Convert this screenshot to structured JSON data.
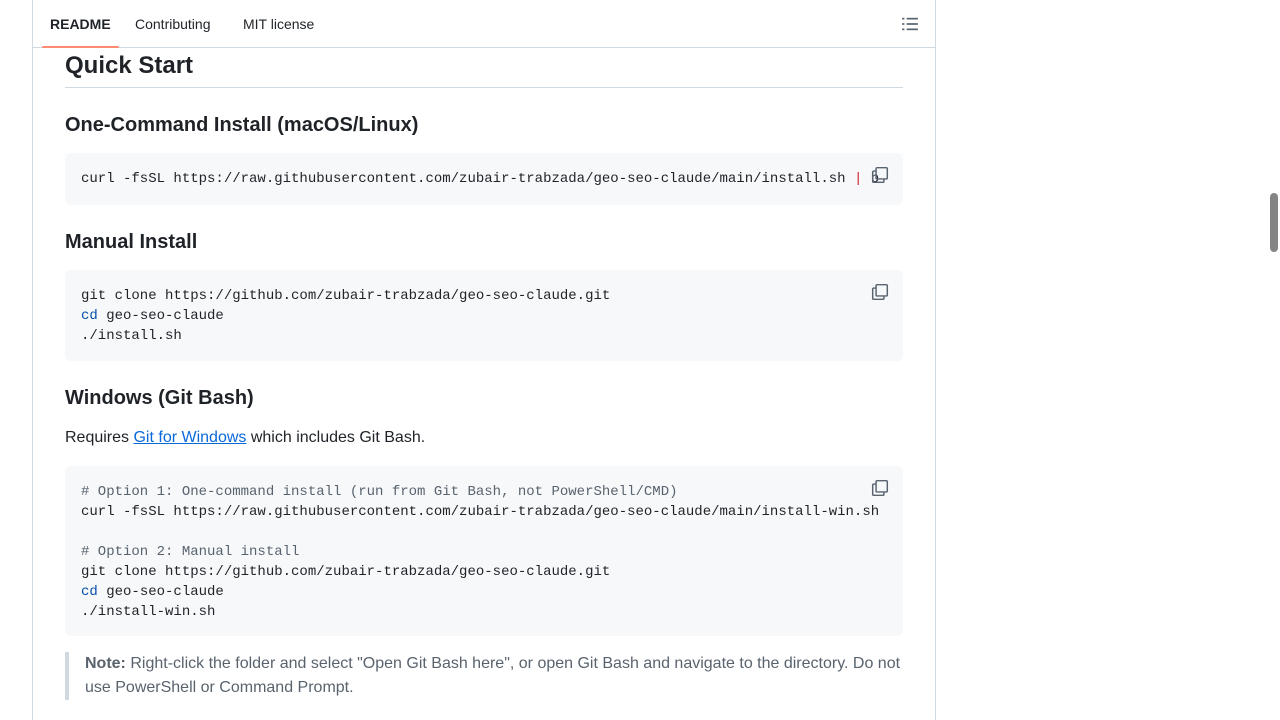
{
  "tabs": [
    {
      "label": "README"
    },
    {
      "label": "Contributing"
    },
    {
      "label": "MIT license"
    }
  ],
  "toc_icon": "list-unordered-icon",
  "copy_icon": "copy-icon",
  "quick_start": {
    "title": "Quick Start"
  },
  "one_command": {
    "title": "One-Command Install (macOS/Linux)",
    "code_before_pipe": "curl -fsSL https://raw.githubusercontent.com/zubair-trabzada/geo-seo-claude/main/install.sh ",
    "pipe": "|",
    "code_after_pipe": " b"
  },
  "manual_install": {
    "title": "Manual Install",
    "line1": "git clone https://github.com/zubair-trabzada/geo-seo-claude.git",
    "line2_cmd": "cd",
    "line2_rest": " geo-seo-claude",
    "line3": "./install.sh"
  },
  "windows": {
    "title": "Windows (Git Bash)",
    "requires_prefix": "Requires ",
    "requires_link": "Git for Windows",
    "requires_suffix": " which includes Git Bash.",
    "comment1": "# Option 1: One-command install (run from Git Bash, not PowerShell/CMD)",
    "line1": "curl -fsSL https://raw.githubusercontent.com/zubair-trabzada/geo-seo-claude/main/install-win.sh",
    "comment2": "# Option 2: Manual install",
    "line2": "git clone https://github.com/zubair-trabzada/geo-seo-claude.git",
    "line3_cmd": "cd",
    "line3_rest": " geo-seo-claude",
    "line4": "./install-win.sh"
  },
  "note": {
    "label": "Note:",
    "text": " Right-click the folder and select \"Open Git Bash here\", or open Git Bash and navigate to the directory. Do not use PowerShell or Command Prompt."
  },
  "colors": {
    "accent_tab_underline": "#fd8c73",
    "link": "#0969da",
    "code_bg": "#f6f8fa",
    "builtin": "#0550ae",
    "pipe": "#cf222e",
    "comment": "#59636e"
  }
}
